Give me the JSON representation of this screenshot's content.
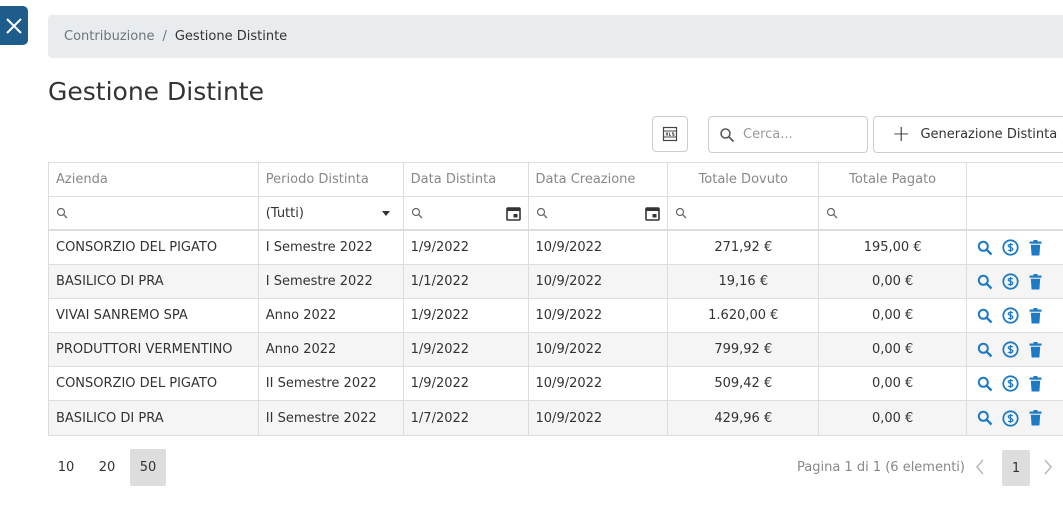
{
  "breadcrumb": {
    "parent": "Contribuzione",
    "separator": "/",
    "current": "Gestione Distinte"
  },
  "page_title": "Gestione Distinte",
  "toolbar": {
    "search_placeholder": "Cerca...",
    "generate_label": "Generazione Distinta",
    "generate_symbol": "+"
  },
  "table": {
    "headers": [
      "Azienda",
      "Periodo Distinta",
      "Data Distinta",
      "Data Creazione",
      "Totale Dovuto",
      "Totale Pagato"
    ],
    "period_filter_value": "(Tutti)",
    "rows": [
      [
        "CONSORZIO DEL PIGATO",
        "I Semestre 2022",
        "1/9/2022",
        "10/9/2022",
        "271,92 €",
        "195,00 €"
      ],
      [
        "BASILICO DI PRA",
        "I Semestre 2022",
        "1/1/2022",
        "10/9/2022",
        "19,16 €",
        "0,00 €"
      ],
      [
        "VIVAI SANREMO SPA",
        "Anno 2022",
        "1/9/2022",
        "10/9/2022",
        "1.620,00 €",
        "0,00 €"
      ],
      [
        "PRODUTTORI VERMENTINO",
        "Anno 2022",
        "1/9/2022",
        "10/9/2022",
        "799,92 €",
        "0,00 €"
      ],
      [
        "CONSORZIO DEL PIGATO",
        "II Semestre 2022",
        "1/9/2022",
        "10/9/2022",
        "509,42 €",
        "0,00 €"
      ],
      [
        "BASILICO DI PRA",
        "II Semestre 2022",
        "1/7/2022",
        "10/9/2022",
        "429,96 €",
        "0,00 €"
      ]
    ]
  },
  "pager": {
    "sizes": [
      "10",
      "20",
      "50"
    ],
    "info": "Pagina 1 di 1 (6 elementi)",
    "current_page": "1"
  },
  "colors": {
    "accent": "#1e5c8c",
    "action_icon": "#1f7ac4",
    "breadcrumb_bg": "#e9ecef"
  }
}
